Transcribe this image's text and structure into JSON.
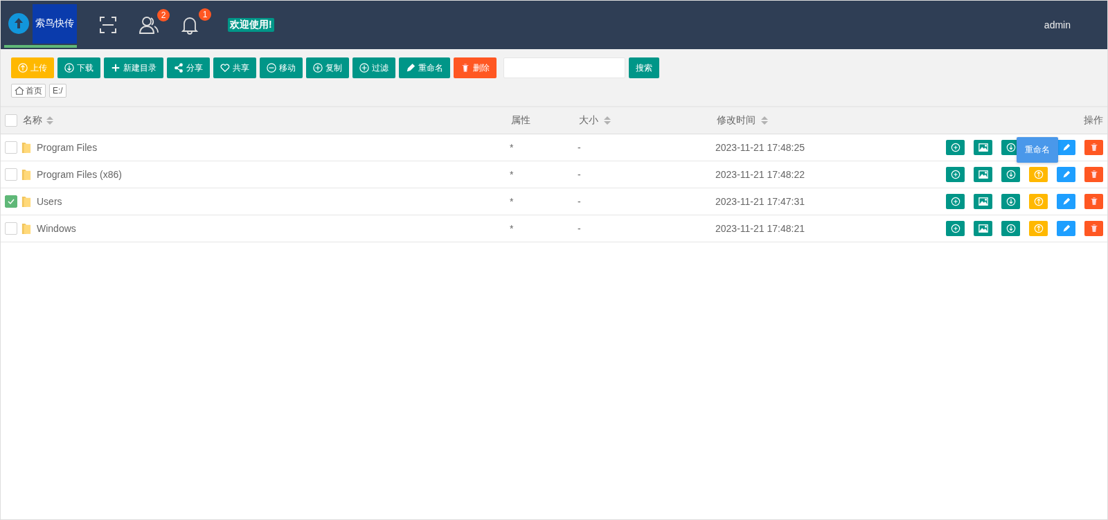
{
  "header": {
    "brand": "索鸟快传",
    "icons": [
      {
        "kind": "scan"
      },
      {
        "kind": "users",
        "badge": "2"
      },
      {
        "kind": "bell",
        "badge": "1"
      }
    ],
    "welcome": "欢迎使用!",
    "user": "admin"
  },
  "toolbar": {
    "buttons": [
      {
        "kind": "upload",
        "label": "上传",
        "color": "#ffb800"
      },
      {
        "kind": "download",
        "label": "下载",
        "color": "#009688"
      },
      {
        "kind": "plus",
        "label": "新建目录",
        "color": "#009688"
      },
      {
        "kind": "share",
        "label": "分享",
        "color": "#009688"
      },
      {
        "kind": "heart",
        "label": "共享",
        "color": "#009688"
      },
      {
        "kind": "minus",
        "label": "移动",
        "color": "#009688"
      },
      {
        "kind": "add",
        "label": "复制",
        "color": "#009688"
      },
      {
        "kind": "add",
        "label": "过滤",
        "color": "#009688"
      },
      {
        "kind": "edit",
        "label": "重命名",
        "color": "#009688"
      },
      {
        "kind": "trash",
        "label": "删除",
        "color": "#ff5722"
      }
    ],
    "search_button": "搜索"
  },
  "breadcrumb": [
    {
      "kind": "home",
      "label": "首页"
    },
    {
      "kind": "path",
      "label": "E:/"
    }
  ],
  "table": {
    "columns": [
      {
        "label": "名称",
        "sortable": true
      },
      {
        "label": "属性",
        "sortable": false
      },
      {
        "label": "大小",
        "sortable": true
      },
      {
        "label": "修改时间",
        "sortable": true
      },
      {
        "label": "操作",
        "sortable": false
      }
    ],
    "all_checked": false,
    "rows": [
      {
        "checked": false,
        "name": "Program Files",
        "attr": "*",
        "size": "-",
        "modified": "2023-11-21 17:48:25",
        "actions": [
          {
            "kind": "add"
          },
          {
            "kind": "image"
          },
          {
            "kind": "download"
          },
          {
            "kind": "edit"
          },
          {
            "kind": "delete"
          }
        ]
      },
      {
        "checked": false,
        "name": "Program Files (x86)",
        "attr": "*",
        "size": "-",
        "modified": "2023-11-21 17:48:22",
        "actions": [
          {
            "kind": "add"
          },
          {
            "kind": "image"
          },
          {
            "kind": "download"
          },
          {
            "kind": "upload"
          },
          {
            "kind": "edit",
            "tooltip": "重命名"
          },
          {
            "kind": "delete"
          }
        ]
      },
      {
        "checked": true,
        "name": "Users",
        "attr": "*",
        "size": "-",
        "modified": "2023-11-21 17:47:31",
        "actions": [
          {
            "kind": "add"
          },
          {
            "kind": "image"
          },
          {
            "kind": "download"
          },
          {
            "kind": "upload"
          },
          {
            "kind": "edit"
          },
          {
            "kind": "delete"
          }
        ]
      },
      {
        "checked": false,
        "name": "Windows",
        "attr": "*",
        "size": "-",
        "modified": "2023-11-21 17:48:21",
        "actions": [
          {
            "kind": "add"
          },
          {
            "kind": "image"
          },
          {
            "kind": "download"
          },
          {
            "kind": "upload"
          },
          {
            "kind": "edit"
          },
          {
            "kind": "delete"
          }
        ]
      }
    ]
  }
}
